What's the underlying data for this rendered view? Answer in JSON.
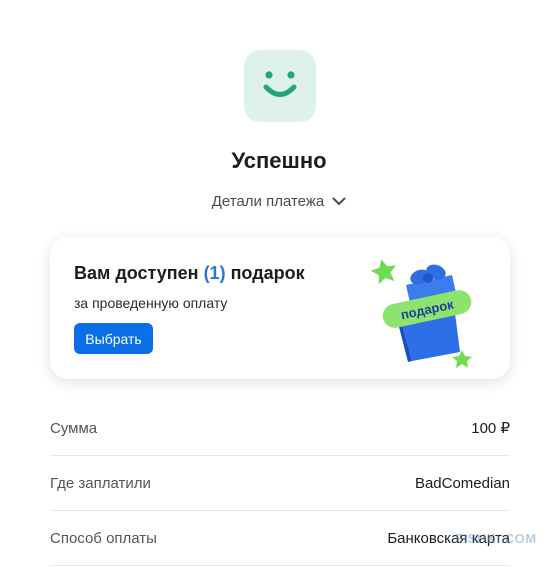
{
  "status": {
    "title": "Успешно",
    "details_label": "Детали платежа"
  },
  "gift_card": {
    "title_prefix": "Вам доступен ",
    "count": "(1)",
    "title_suffix": " подарок",
    "subtitle": "за проведенную оплату",
    "button_label": "Выбрать",
    "badge": "подарок"
  },
  "rows": [
    {
      "label": "Сумма",
      "value": "100 ₽"
    },
    {
      "label": "Где заплатили",
      "value": "BadComedian"
    },
    {
      "label": "Способ оплаты",
      "value": "Банковская карта"
    }
  ],
  "watermark": "FISHKI.COM",
  "colors": {
    "accent": "#1f7ae0",
    "button": "#0a6ee6",
    "smile": "#21a675",
    "tile": "#dff1ec",
    "gift_badge": "#8ee36e"
  },
  "icons": {
    "status": "smile-icon",
    "details": "chevron-down-icon",
    "gift": "gift-box-icon"
  }
}
